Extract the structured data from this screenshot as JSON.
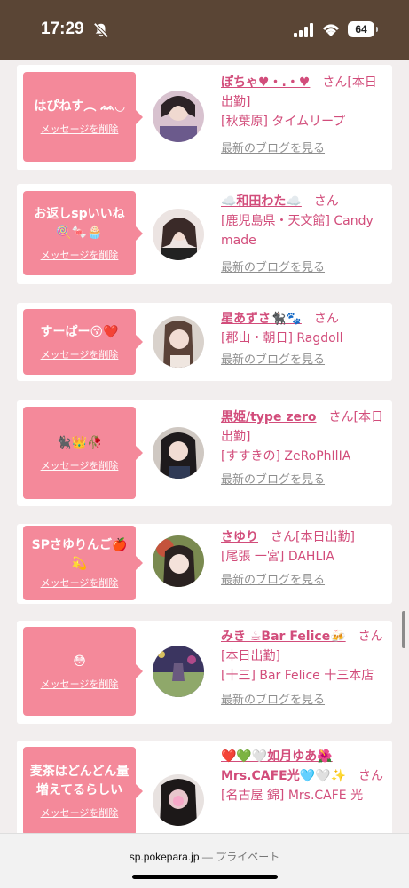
{
  "status_bar": {
    "time": "17:29",
    "battery": "64"
  },
  "delete_label": "メッセージを削除",
  "san_suffix": "さん",
  "blog_label": "最新のブログを見る",
  "cards": [
    {
      "message": "はぴねす︵ ᨐ◡",
      "name": "ぽちゃ♥・.・♥",
      "status": "[本日出勤]",
      "shop": "[秋葉原] タイムリープ"
    },
    {
      "message": "お返しspいいね 🍭🍬🧁",
      "name": "☁️和田わた☁️",
      "status": "",
      "shop": "[鹿児島県・天文館] Candy made"
    },
    {
      "message": "すーぱー😚❤️",
      "name": "星あずさ🐈‍⬛🐾",
      "status": "",
      "shop": "[郡山・朝日] Ragdoll"
    },
    {
      "message": "🐈‍⬛👑🥀",
      "name": "黒姫/type zero",
      "status": "[本日出勤]",
      "shop": "[すすきの] ZeRoPhIlIA"
    },
    {
      "message": "SPさゆりんご🍎 💫",
      "name": "さゆり",
      "status": "[本日出勤]",
      "shop": "[尾張 一宮] DAHLIA"
    },
    {
      "message": "😳",
      "name": "みき ☕Bar Felice🍻",
      "status": "[本日出勤]",
      "shop": "[十三] Bar Felice 十三本店"
    },
    {
      "message": "麦茶はどんどん量増えてるらしい",
      "name": "❤️💚🤍如月ゆあ🌺Mrs.CAFE光🩵🤍✨",
      "status": "",
      "shop": "[名古屋 錦] Mrs.CAFE 光"
    }
  ],
  "browser": {
    "domain": "sp.pokepara.jp",
    "separator": " — ",
    "mode": "プライベート"
  }
}
